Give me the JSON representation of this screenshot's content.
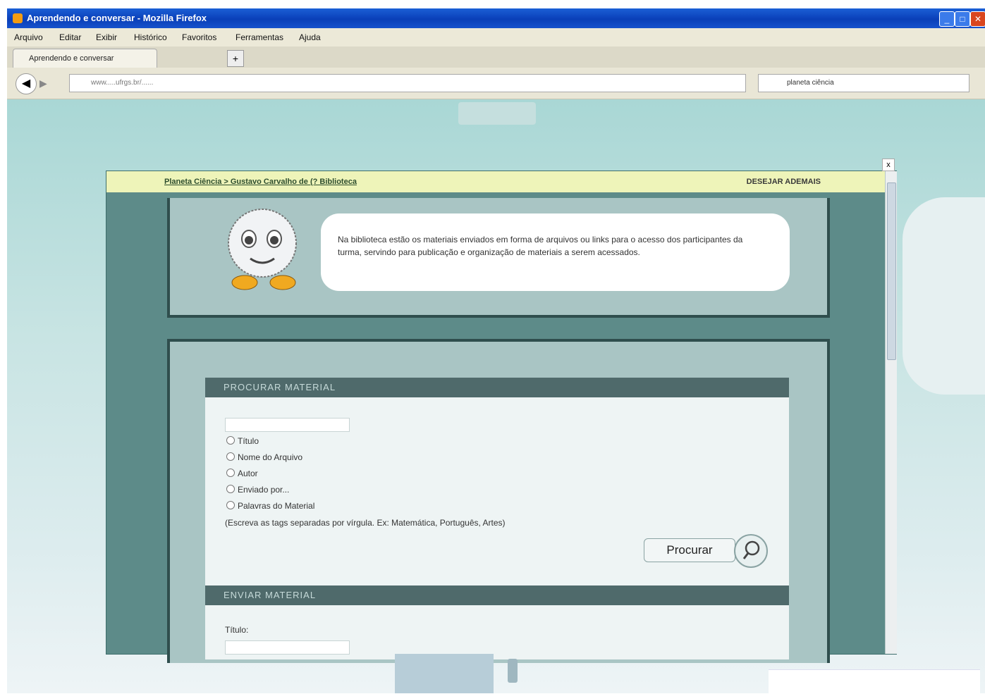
{
  "window": {
    "title": "Aprendendo e conversar - Mozilla Firefox",
    "buttons": {
      "minimize": "_",
      "maximize": "□",
      "close": "✕"
    }
  },
  "menubar": [
    "Arquivo",
    "Editar",
    "Exibir",
    "Histórico",
    "Favoritos",
    "Ferramentas",
    "Ajuda"
  ],
  "tabs": {
    "active_label": "Aprendendo e conversar",
    "new_tab_label": "+"
  },
  "navbar": {
    "url": "www.....ufrgs.br/......",
    "search_value": "planeta ciência"
  },
  "dialog": {
    "breadcrumb": "Planeta Ciência > Gustavo Carvalho de (? Biblioteca",
    "header_right": "DESEJAR ADEMAIS",
    "close_label": "x",
    "intro_text": "Na biblioteca estão os materiais enviados em forma de arquivos ou links para o acesso dos participantes da turma, servindo para publicação e organização de materiais a serem acessados.",
    "search_section": {
      "title": "PROCURAR MATERIAL",
      "input_value": "",
      "options": [
        "Título",
        "Nome do Arquivo",
        "Autor",
        "Enviado por...",
        "Palavras do Material"
      ],
      "hint": "(Escreva as tags separadas por vírgula. Ex: Matemática, Português, Artes)",
      "button_label": "Procurar"
    },
    "send_section": {
      "title": "ENVIAR MATERIAL",
      "titulo_label": "Título:",
      "titulo_value": ""
    }
  },
  "colors": {
    "titlebar": "#0a3fb8",
    "dialog_frame": "#5d8b89",
    "panel": "#a9c5c4",
    "section_header": "#4f6a6b",
    "header_strip": "#eef4b9"
  }
}
